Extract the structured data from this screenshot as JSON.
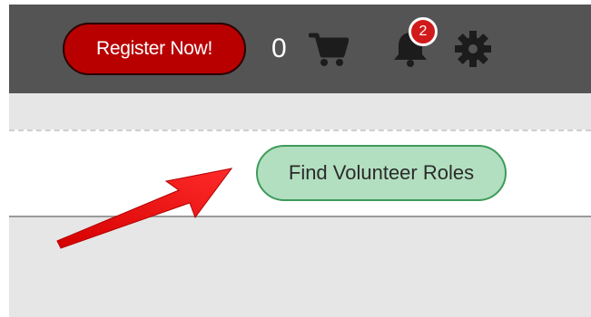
{
  "header": {
    "register_label": "Register Now!",
    "cart_count": "0",
    "cart_icon": "shopping-cart-icon",
    "notification_icon": "bell-icon",
    "notification_badge": "2",
    "settings_icon": "gear-icon"
  },
  "main": {
    "find_roles_label": "Find Volunteer Roles"
  },
  "annotation": {
    "arrow_icon": "red-arrow-icon"
  },
  "colors": {
    "topbar_bg": "#545454",
    "register_bg": "#b80000",
    "badge_bg": "#d11a1a",
    "find_button_bg": "#b2dfc0",
    "find_button_border": "#3d9b5a",
    "subbar_bg": "#e6e6e6",
    "arrow": "#ee1c1c"
  }
}
